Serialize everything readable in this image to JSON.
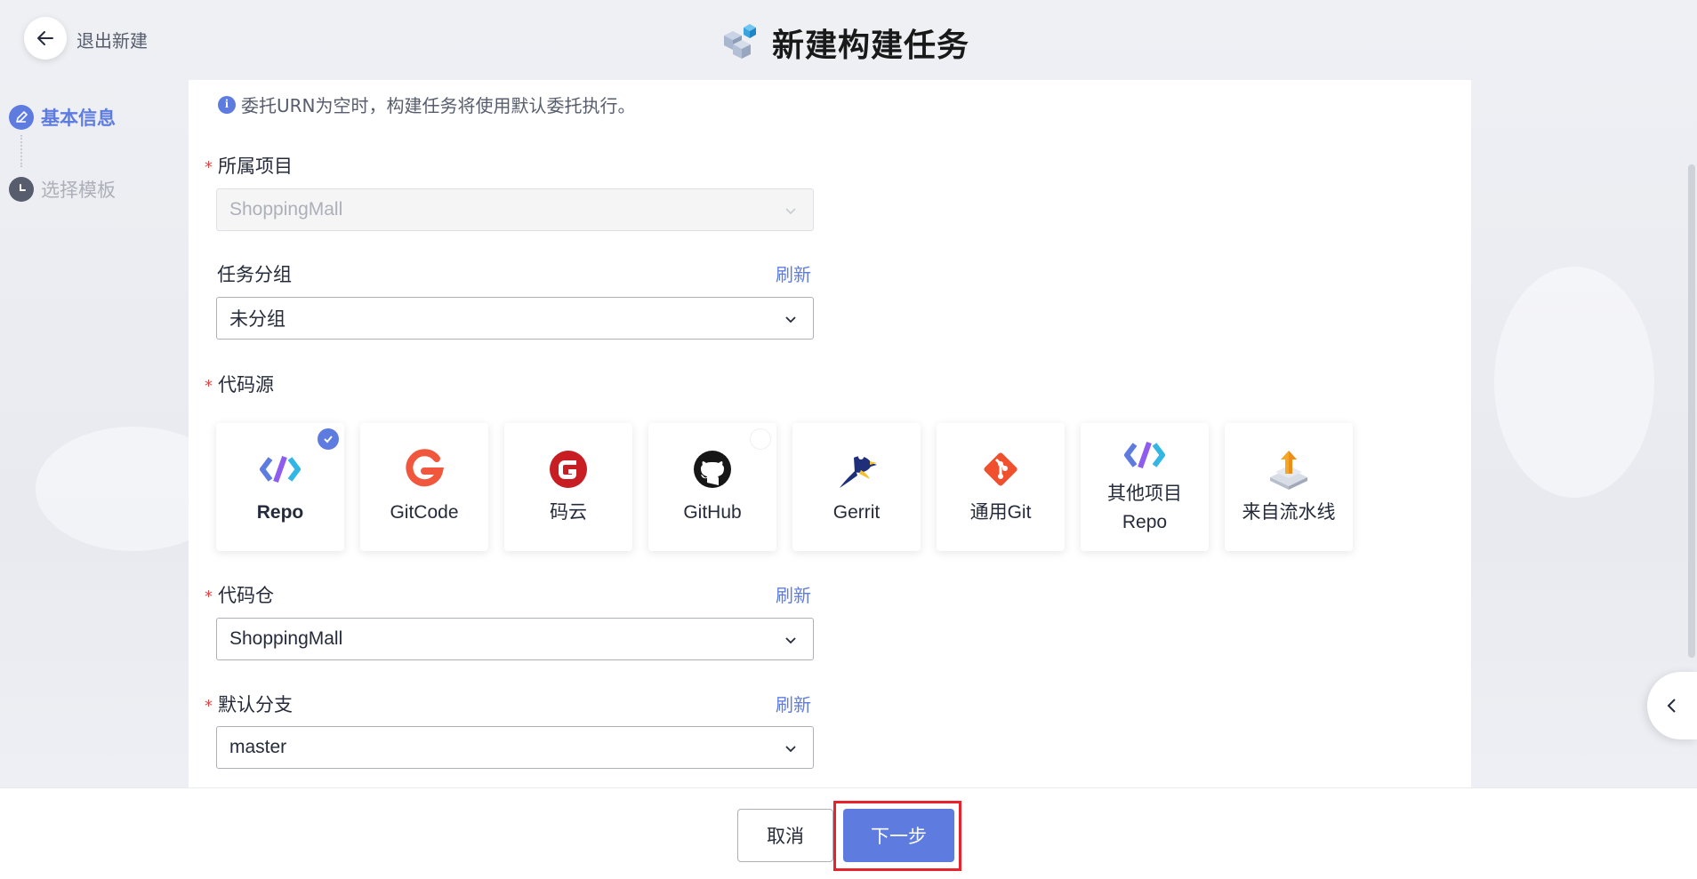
{
  "header": {
    "back_label": "退出新建",
    "title": "新建构建任务"
  },
  "steps": [
    {
      "label": "基本信息",
      "state": "active"
    },
    {
      "label": "选择模板",
      "state": "pending"
    }
  ],
  "info": {
    "text": "委托URN为空时，构建任务将使用默认委托执行。"
  },
  "form": {
    "project": {
      "label": "所属项目",
      "required": true,
      "value": "ShoppingMall",
      "disabled": true
    },
    "group": {
      "label": "任务分组",
      "required": false,
      "value": "未分组",
      "refresh": "刷新"
    },
    "code_source": {
      "label": "代码源",
      "required": true,
      "options": [
        {
          "label": "Repo",
          "icon": "repo-icon",
          "selected": true
        },
        {
          "label": "GitCode",
          "icon": "gitcode-icon",
          "selected": false
        },
        {
          "label": "码云",
          "icon": "gitee-icon",
          "selected": false
        },
        {
          "label": "GitHub",
          "icon": "github-icon",
          "selected": false
        },
        {
          "label": "Gerrit",
          "icon": "gerrit-icon",
          "selected": false
        },
        {
          "label": "通用Git",
          "icon": "git-icon",
          "selected": false
        },
        {
          "label": "其他项目Repo",
          "icon": "repo-icon",
          "selected": false
        },
        {
          "label": "来自流水线",
          "icon": "pipeline-icon",
          "selected": false
        }
      ]
    },
    "repo": {
      "label": "代码仓",
      "required": true,
      "value": "ShoppingMall",
      "refresh": "刷新"
    },
    "branch": {
      "label": "默认分支",
      "required": true,
      "value": "master",
      "refresh": "刷新"
    }
  },
  "footer": {
    "cancel_label": "取消",
    "next_label": "下一步"
  },
  "colors": {
    "accent": "#5e7ce0",
    "required": "#e54545",
    "highlight": "#e8232c"
  }
}
